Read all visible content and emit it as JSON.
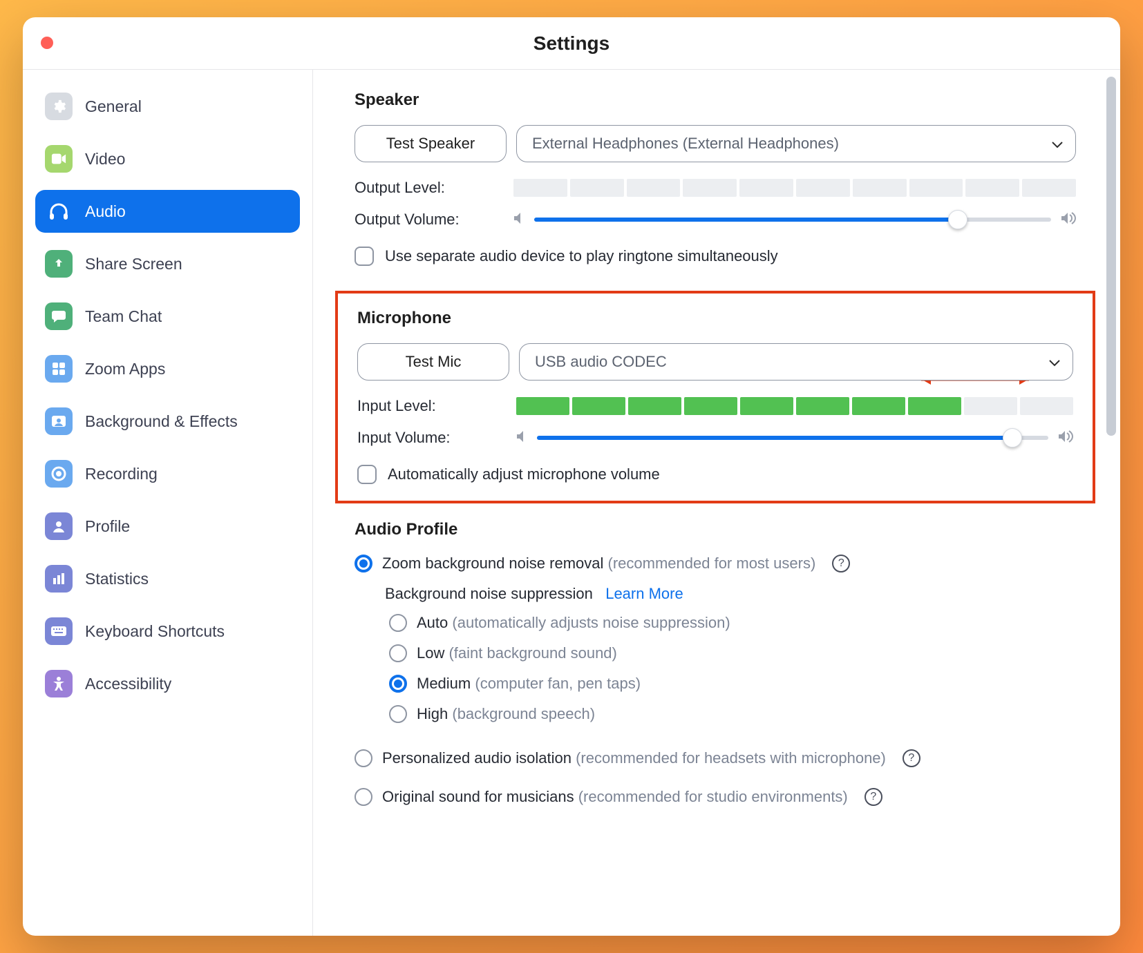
{
  "window": {
    "title": "Settings"
  },
  "sidebar": {
    "items": [
      {
        "id": "general",
        "label": "General"
      },
      {
        "id": "video",
        "label": "Video"
      },
      {
        "id": "audio",
        "label": "Audio",
        "active": true
      },
      {
        "id": "share",
        "label": "Share Screen"
      },
      {
        "id": "chat",
        "label": "Team Chat"
      },
      {
        "id": "apps",
        "label": "Zoom Apps"
      },
      {
        "id": "bg",
        "label": "Background & Effects"
      },
      {
        "id": "recording",
        "label": "Recording"
      },
      {
        "id": "profile",
        "label": "Profile"
      },
      {
        "id": "stats",
        "label": "Statistics"
      },
      {
        "id": "keyboard",
        "label": "Keyboard Shortcuts"
      },
      {
        "id": "a11y",
        "label": "Accessibility"
      }
    ]
  },
  "speaker": {
    "heading": "Speaker",
    "test_label": "Test Speaker",
    "device": "External Headphones (External Headphones)",
    "output_level_label": "Output Level:",
    "output_level_segments": 10,
    "output_level_active": 0,
    "output_volume_label": "Output Volume:",
    "output_volume_percent": 82,
    "separate_ringtone_label": "Use separate audio device to play ringtone simultaneously",
    "separate_ringtone_checked": false
  },
  "microphone": {
    "heading": "Microphone",
    "test_label": "Test Mic",
    "device": "USB audio CODEC",
    "input_level_label": "Input Level:",
    "input_level_segments": 10,
    "input_level_active": 8,
    "input_volume_label": "Input Volume:",
    "input_volume_percent": 93,
    "auto_adjust_label": "Automatically adjust microphone volume",
    "auto_adjust_checked": false
  },
  "audio_profile": {
    "heading": "Audio Profile",
    "options": [
      {
        "id": "zoom_noise_removal",
        "label": "Zoom background noise removal",
        "hint": "(recommended for most users)",
        "selected": true,
        "help": true,
        "sub": {
          "title": "Background noise suppression",
          "learn_more": "Learn More",
          "choices": [
            {
              "id": "auto",
              "label": "Auto",
              "hint": "(automatically adjusts noise suppression)",
              "selected": false
            },
            {
              "id": "low",
              "label": "Low",
              "hint": "(faint background sound)",
              "selected": false
            },
            {
              "id": "medium",
              "label": "Medium",
              "hint": "(computer fan, pen taps)",
              "selected": true
            },
            {
              "id": "high",
              "label": "High",
              "hint": "(background speech)",
              "selected": false
            }
          ]
        }
      },
      {
        "id": "personalized_isolation",
        "label": "Personalized audio isolation",
        "hint": "(recommended for headsets with microphone)",
        "selected": false,
        "help": true
      },
      {
        "id": "original_sound",
        "label": "Original sound for musicians",
        "hint": "(recommended for studio environments)",
        "selected": false,
        "help": true
      }
    ]
  }
}
